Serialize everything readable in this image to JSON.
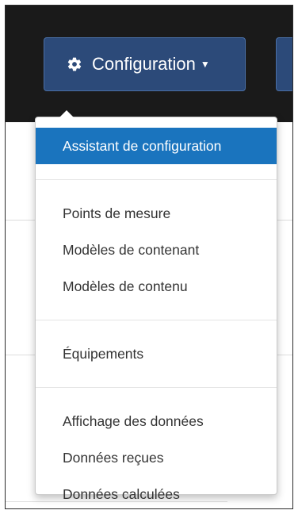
{
  "toolbar": {
    "configuration_label": "Configuration",
    "gear_icon": "gear-icon",
    "caret_icon": "caret-down-icon"
  },
  "menu": {
    "active_color": "#1a74be",
    "groups": [
      {
        "items": [
          {
            "label": "Assistant de configuration",
            "active": true
          }
        ]
      },
      {
        "items": [
          {
            "label": "Points de mesure"
          },
          {
            "label": "Modèles de contenant"
          },
          {
            "label": "Modèles de contenu"
          }
        ]
      },
      {
        "items": [
          {
            "label": "Équipements"
          }
        ]
      },
      {
        "items": [
          {
            "label": "Affichage des données"
          },
          {
            "label": "Données reçues"
          },
          {
            "label": "Données calculées"
          }
        ]
      }
    ]
  }
}
